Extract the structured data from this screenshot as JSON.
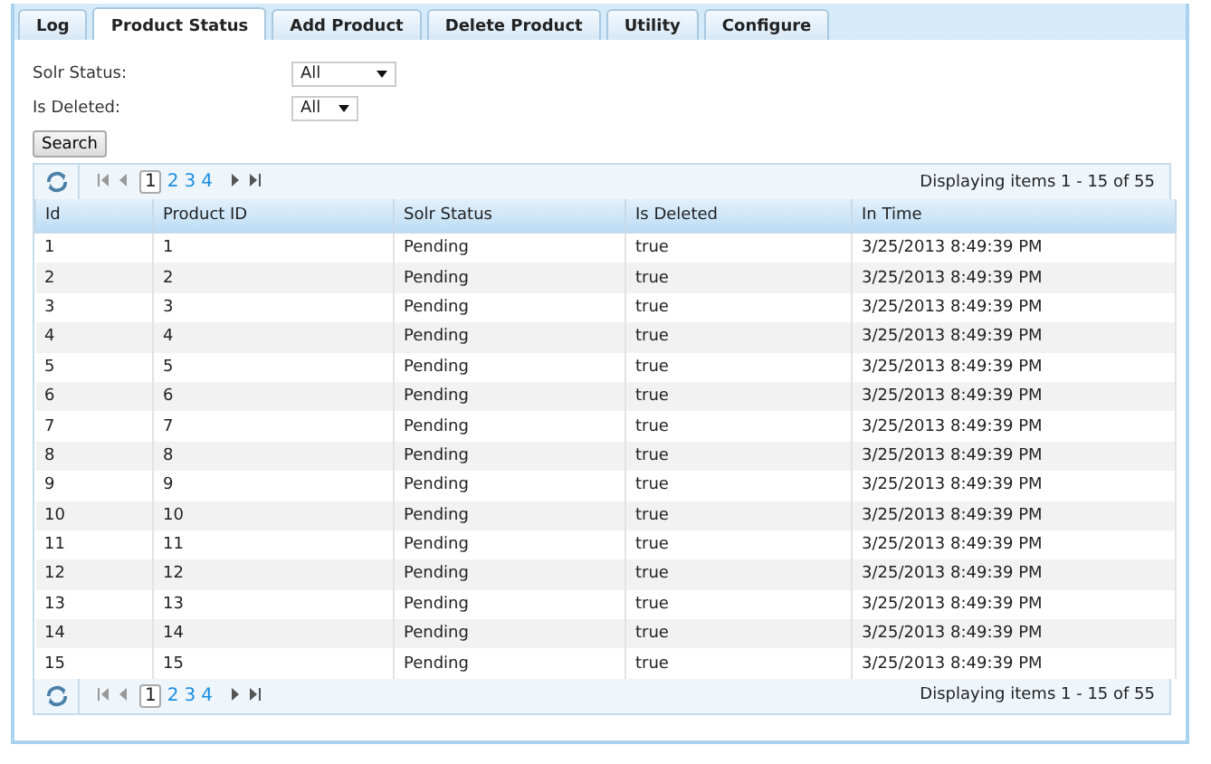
{
  "tabs": [
    {
      "label": "Log",
      "selected": false
    },
    {
      "label": "Product Status",
      "selected": true
    },
    {
      "label": "Add Product",
      "selected": false
    },
    {
      "label": "Delete Product",
      "selected": false
    },
    {
      "label": "Utility",
      "selected": false
    },
    {
      "label": "Configure",
      "selected": false
    }
  ],
  "filters": [
    {
      "label": "Solr Status:",
      "value": "All",
      "wide": true
    },
    {
      "label": "Is Deleted:",
      "value": "All",
      "wide": false
    }
  ],
  "search_button": "Search",
  "pager_top": {
    "pages": [
      {
        "label": "1",
        "selected": true
      },
      {
        "label": "2",
        "selected": false
      },
      {
        "label": "3",
        "selected": false
      },
      {
        "label": "4",
        "selected": false
      }
    ],
    "info": "Displaying items 1 - 15 of 55"
  },
  "table": {
    "columns": [
      "Id",
      "Product ID",
      "Solr Status",
      "Is Deleted",
      "In Time"
    ],
    "rows": [
      [
        "1",
        "1",
        "Pending",
        "true",
        "3/25/2013 8:49:39 PM"
      ],
      [
        "2",
        "2",
        "Pending",
        "true",
        "3/25/2013 8:49:39 PM"
      ],
      [
        "3",
        "3",
        "Pending",
        "true",
        "3/25/2013 8:49:39 PM"
      ],
      [
        "4",
        "4",
        "Pending",
        "true",
        "3/25/2013 8:49:39 PM"
      ],
      [
        "5",
        "5",
        "Pending",
        "true",
        "3/25/2013 8:49:39 PM"
      ],
      [
        "6",
        "6",
        "Pending",
        "true",
        "3/25/2013 8:49:39 PM"
      ],
      [
        "7",
        "7",
        "Pending",
        "true",
        "3/25/2013 8:49:39 PM"
      ],
      [
        "8",
        "8",
        "Pending",
        "true",
        "3/25/2013 8:49:39 PM"
      ],
      [
        "9",
        "9",
        "Pending",
        "true",
        "3/25/2013 8:49:39 PM"
      ],
      [
        "10",
        "10",
        "Pending",
        "true",
        "3/25/2013 8:49:39 PM"
      ],
      [
        "11",
        "11",
        "Pending",
        "true",
        "3/25/2013 8:49:39 PM"
      ],
      [
        "12",
        "12",
        "Pending",
        "true",
        "3/25/2013 8:49:39 PM"
      ],
      [
        "13",
        "13",
        "Pending",
        "true",
        "3/25/2013 8:49:39 PM"
      ],
      [
        "14",
        "14",
        "Pending",
        "true",
        "3/25/2013 8:49:39 PM"
      ],
      [
        "15",
        "15",
        "Pending",
        "true",
        "3/25/2013 8:49:39 PM"
      ]
    ]
  },
  "pager_bottom": {
    "pages": [
      {
        "label": "1",
        "selected": true
      },
      {
        "label": "2",
        "selected": false
      },
      {
        "label": "3",
        "selected": false
      },
      {
        "label": "4",
        "selected": false
      }
    ],
    "info": "Displaying items 1 - 15 of 55"
  }
}
